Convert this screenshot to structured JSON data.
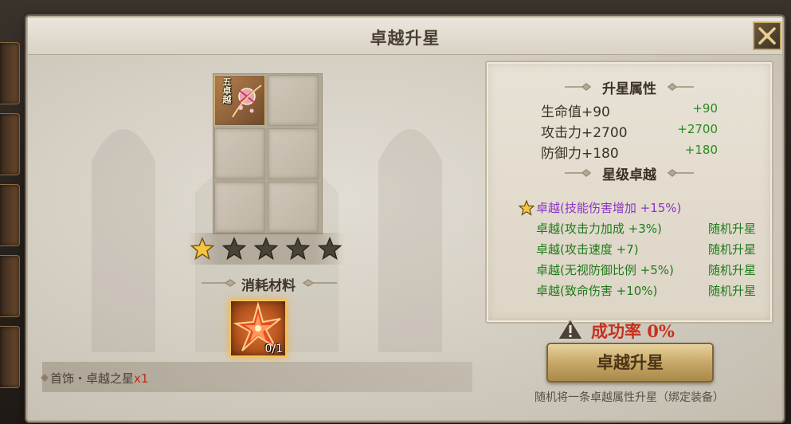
{
  "window": {
    "title": "卓越升星"
  },
  "item": {
    "tier_label": "五卓越"
  },
  "stars": {
    "filled": 1,
    "total": 5
  },
  "materials": {
    "heading": "消耗材料",
    "count_text": "0/1",
    "name": "首饰・卓越之星",
    "qty": "x1"
  },
  "attributes": {
    "heading": "升星属性",
    "stats": [
      {
        "label": "生命值+90",
        "inc": "+90"
      },
      {
        "label": "攻击力+2700",
        "inc": "+2700"
      },
      {
        "label": "防御力+180",
        "inc": "+180"
      }
    ]
  },
  "excellence": {
    "heading": "星级卓越",
    "rows": [
      {
        "text": "卓越(技能伤害增加 +15%)",
        "tag": "",
        "starred": true
      },
      {
        "text": "卓越(攻击力加成 +3%)",
        "tag": "随机升星",
        "starred": false
      },
      {
        "text": "卓越(攻击速度 +7)",
        "tag": "随机升星",
        "starred": false
      },
      {
        "text": "卓越(无视防御比例 +5%)",
        "tag": "随机升星",
        "starred": false
      },
      {
        "text": "卓越(致命伤害 +10%)",
        "tag": "随机升星",
        "starred": false
      }
    ]
  },
  "success": {
    "text": "成功率 0%"
  },
  "upgrade": {
    "label": "卓越升星"
  },
  "note": {
    "text": "随机将一条卓越属性升星（绑定装备）"
  },
  "colors": {
    "accent_gold": "#c9a766",
    "success_red": "#c7301d",
    "green": "#2a8a1f",
    "purple": "#8b34c7"
  }
}
